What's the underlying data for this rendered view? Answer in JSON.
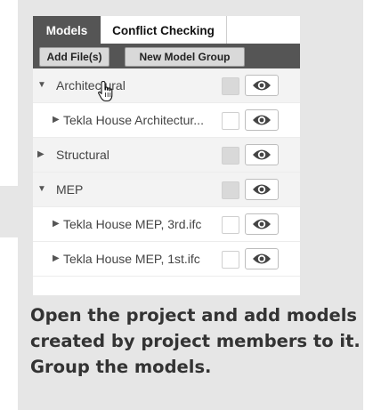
{
  "tabs": [
    {
      "label": "Models",
      "active": true
    },
    {
      "label": "Conflict Checking",
      "active": false
    }
  ],
  "toolbar": {
    "add_files_label": "Add File(s)",
    "new_group_label": "New Model Group"
  },
  "tree": [
    {
      "type": "group",
      "label": "Architectural",
      "expanded": true,
      "arrow": "▼"
    },
    {
      "type": "model",
      "label": "Tekla House Architectur...",
      "arrow": "▶"
    },
    {
      "type": "group",
      "label": "Structural",
      "expanded": false,
      "arrow": "▶"
    },
    {
      "type": "group",
      "label": "MEP",
      "expanded": true,
      "arrow": "▼"
    },
    {
      "type": "model",
      "label": "Tekla House MEP, 3rd.ifc",
      "arrow": "▶"
    },
    {
      "type": "model",
      "label": "Tekla House MEP, 1st.ifc",
      "arrow": "▶"
    }
  ],
  "caption": "Open the project and add models created by project members to it. Group the models.",
  "icons": {
    "visibility": "eye-icon",
    "cursor": "hand-pointer-icon"
  },
  "colors": {
    "header_bg": "#555555",
    "card_bg": "#e6e6e6",
    "group_row_bg": "#f3f3f3"
  }
}
